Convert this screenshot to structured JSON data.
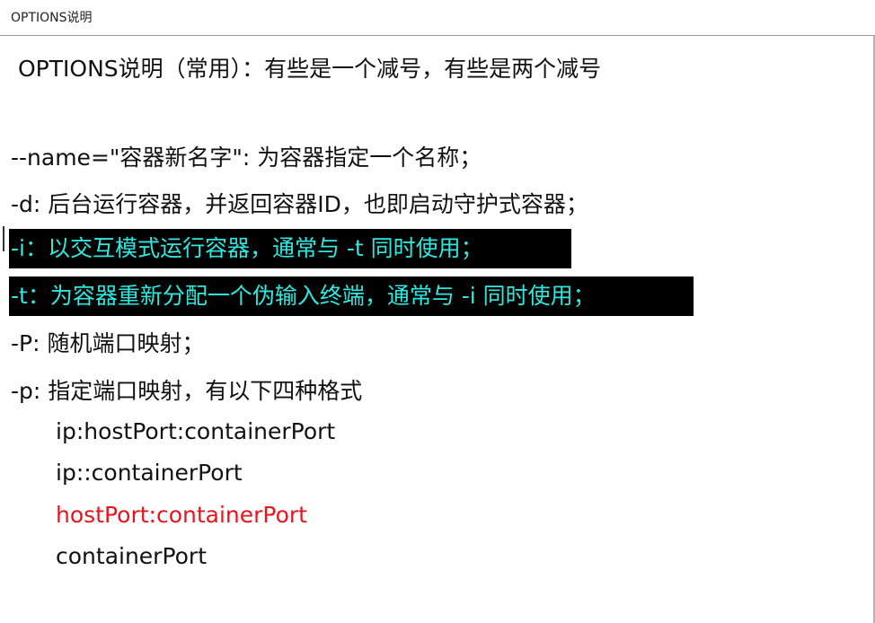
{
  "window": {
    "title": "OPTIONS说明"
  },
  "content": {
    "heading": "OPTIONS说明（常用）：有些是一个减号，有些是两个减号",
    "options": [
      {
        "text": "--name=\"容器新名字\": 为容器指定一个名称；"
      },
      {
        "text": "-d: 后台运行容器，并返回容器ID，也即启动守护式容器；"
      },
      {
        "text": "-i：以交互模式运行容器，通常与 -t 同时使用；"
      },
      {
        "text": "-t：为容器重新分配一个伪输入终端，通常与 -i 同时使用；"
      },
      {
        "text": "-P: 随机端口映射；"
      },
      {
        "text": "-p: 指定端口映射，有以下四种格式"
      }
    ],
    "port_formats": [
      {
        "text": "ip:hostPort:containerPort"
      },
      {
        "text": "ip::containerPort"
      },
      {
        "text": "hostPort:containerPort"
      },
      {
        "text": "containerPort"
      }
    ]
  },
  "colors": {
    "highlight_background": "#000000",
    "highlight_text": "#2ee8e0",
    "emphasis_red": "#e8141e"
  }
}
